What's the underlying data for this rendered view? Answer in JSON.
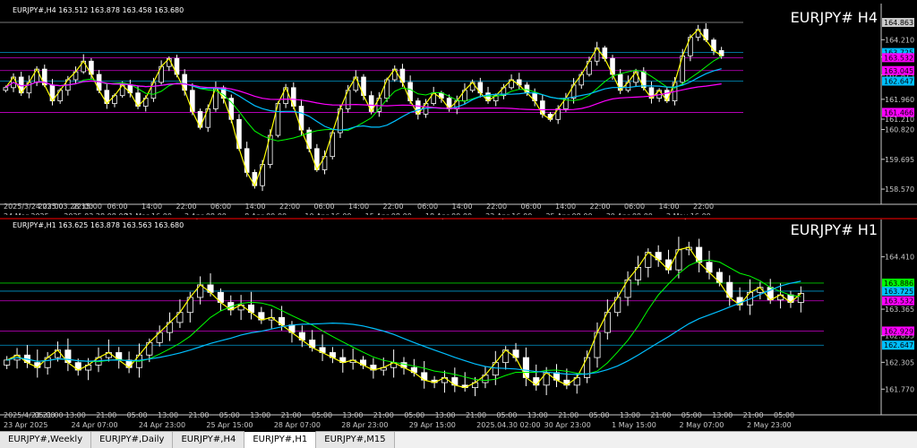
{
  "colors": {
    "background": "#000000",
    "up_candle": "#ffffff",
    "down_candle": "#ffffff",
    "zigzag": "#ffff00",
    "ma_fast": "#00ff00",
    "ma_slow": "#00bfff",
    "ma_long": "#ff00ff",
    "trend": "#ffffff",
    "grid_text": "#c8c8c8",
    "price_tag_blue": "#00bfff",
    "price_tag_magenta": "#ff00ff",
    "price_tag_green": "#00ff00",
    "price_tag_white": "#c8c8c8",
    "separator_red": "#ff0000"
  },
  "chart_data": [
    {
      "type": "candlestick",
      "header": "EURJPY#,H4  163.512 163.878 163.458 163.680",
      "watermark": "EURJPY#  H4",
      "ylim": [
        158.2,
        165.1
      ],
      "price_axis": [
        "164.210",
        "163.560",
        "162.875",
        "161.960",
        "161.210",
        "160.820",
        "159.695",
        "158.570"
      ],
      "price_tags": [
        {
          "label": "164.863",
          "value": 164.863,
          "color": "#c8c8c8"
        },
        {
          "label": "163.725",
          "value": 163.725,
          "color": "#00bfff"
        },
        {
          "label": "163.532",
          "value": 163.532,
          "color": "#ff00ff"
        },
        {
          "label": "163.045",
          "value": 163.045,
          "color": "#ff00ff"
        },
        {
          "label": "162.647",
          "value": 162.647,
          "color": "#00bfff"
        },
        {
          "label": "161.466",
          "value": 161.466,
          "color": "#ff00ff"
        }
      ],
      "time_labels": [
        "2025/3/24 23:00",
        "2025.03.28 15:00",
        "22:00",
        "06:00",
        "14:00",
        "22:00",
        "06:00",
        "14:00",
        "22:00",
        "06:00",
        "14:00",
        "22:00",
        "06:00",
        "14:00",
        "22:00",
        "06:00",
        "14:00",
        "22:00",
        "06:00",
        "14:00",
        "22:00"
      ],
      "date_labels": [
        "24 Mar 2025",
        "2025.03.28 08:00",
        "31 Mar 16:00",
        "3 Apr 08:00",
        "8 Apr 00:00",
        "10 Apr 16:00",
        "15 Apr 08:00",
        "18 Apr 00:00",
        "22 Apr 16:00",
        "25 Apr 08:00",
        "30 Apr 00:00",
        "2 May 16:00"
      ],
      "close": [
        162.4,
        162.8,
        162.2,
        162.6,
        163.1,
        162.5,
        161.9,
        162.3,
        162.7,
        163.0,
        163.4,
        162.9,
        162.3,
        161.8,
        162.1,
        162.5,
        162.2,
        161.7,
        162.0,
        162.6,
        163.2,
        163.5,
        162.9,
        162.3,
        161.5,
        160.9,
        161.6,
        162.4,
        162.0,
        161.2,
        160.1,
        159.2,
        158.7,
        159.5,
        160.6,
        161.8,
        162.4,
        161.7,
        160.8,
        160.1,
        159.3,
        159.8,
        160.7,
        161.6,
        162.3,
        162.8,
        162.1,
        161.5,
        162.0,
        162.7,
        163.1,
        162.6,
        161.9,
        161.4,
        161.8,
        162.2,
        162.0,
        161.6,
        161.9,
        162.3,
        162.6,
        162.2,
        161.9,
        162.1,
        162.4,
        162.7,
        162.5,
        162.2,
        161.9,
        161.4,
        161.2,
        161.6,
        162.0,
        162.5,
        162.9,
        163.4,
        163.9,
        163.5,
        162.9,
        162.3,
        162.6,
        163.0,
        162.4,
        162.0,
        162.3,
        161.9,
        162.6,
        163.6,
        164.3,
        164.6,
        164.2,
        163.8,
        163.6
      ]
    },
    {
      "type": "candlestick",
      "header": "EURJPY#,H1  163.625 163.878 163.563 163.680",
      "watermark": "EURJPY#  H1",
      "ylim": [
        161.4,
        164.85
      ],
      "price_axis": [
        "164.410",
        "163.365",
        "162.835",
        "162.305",
        "161.770"
      ],
      "price_tags": [
        {
          "label": "163.886",
          "value": 163.886,
          "color": "#00ff00"
        },
        {
          "label": "163.725",
          "value": 163.725,
          "color": "#00bfff"
        },
        {
          "label": "163.532",
          "value": 163.532,
          "color": "#ff00ff"
        },
        {
          "label": "162.929",
          "value": 162.929,
          "color": "#ff00ff"
        },
        {
          "label": "162.647",
          "value": 162.647,
          "color": "#00bfff"
        }
      ],
      "time_labels": [
        "2025/4/23 21:00",
        "05:00",
        "13:00",
        "21:00",
        "05:00",
        "13:00",
        "21:00",
        "05:00",
        "13:00",
        "21:00",
        "05:00",
        "13:00",
        "21:00",
        "05:00",
        "13:00",
        "21:00",
        "05:00",
        "13:00",
        "21:00",
        "05:00",
        "13:00",
        "21:00",
        "05:00",
        "13:00",
        "21:00",
        "05:00"
      ],
      "date_labels": [
        "23 Apr 2025",
        "24 Apr 07:00",
        "24 Apr 23:00",
        "25 Apr 15:00",
        "28 Apr 07:00",
        "28 Apr 23:00",
        "29 Apr 15:00",
        "2025.04.30 02:00",
        "30 Apr 23:00",
        "1 May 15:00",
        "2 May 07:00",
        "2 May 23:00"
      ],
      "close": [
        162.35,
        162.45,
        162.3,
        162.2,
        162.4,
        162.55,
        162.3,
        162.15,
        162.25,
        162.4,
        162.5,
        162.35,
        162.2,
        162.45,
        162.7,
        162.9,
        163.1,
        163.3,
        163.6,
        163.85,
        163.7,
        163.5,
        163.35,
        163.45,
        163.3,
        163.15,
        163.2,
        163.05,
        162.9,
        162.75,
        162.6,
        162.5,
        162.4,
        162.3,
        162.35,
        162.25,
        162.15,
        162.2,
        162.3,
        162.2,
        162.1,
        161.95,
        161.9,
        162.0,
        161.85,
        161.8,
        161.9,
        162.05,
        162.3,
        162.55,
        162.4,
        162.0,
        161.85,
        162.1,
        161.95,
        161.85,
        162.0,
        162.4,
        162.9,
        163.3,
        163.6,
        163.95,
        164.2,
        164.5,
        164.35,
        164.15,
        164.55,
        164.6,
        164.3,
        164.1,
        163.9,
        163.6,
        163.45,
        163.7,
        163.8,
        163.55,
        163.65,
        163.5,
        163.68
      ]
    }
  ],
  "tabs": [
    {
      "label": "EURJPY#,Weekly",
      "active": false
    },
    {
      "label": "EURJPY#,Daily",
      "active": false
    },
    {
      "label": "EURJPY#,H4",
      "active": false
    },
    {
      "label": "EURJPY#,H1",
      "active": true
    },
    {
      "label": "EURJPY#,M15",
      "active": false
    }
  ]
}
